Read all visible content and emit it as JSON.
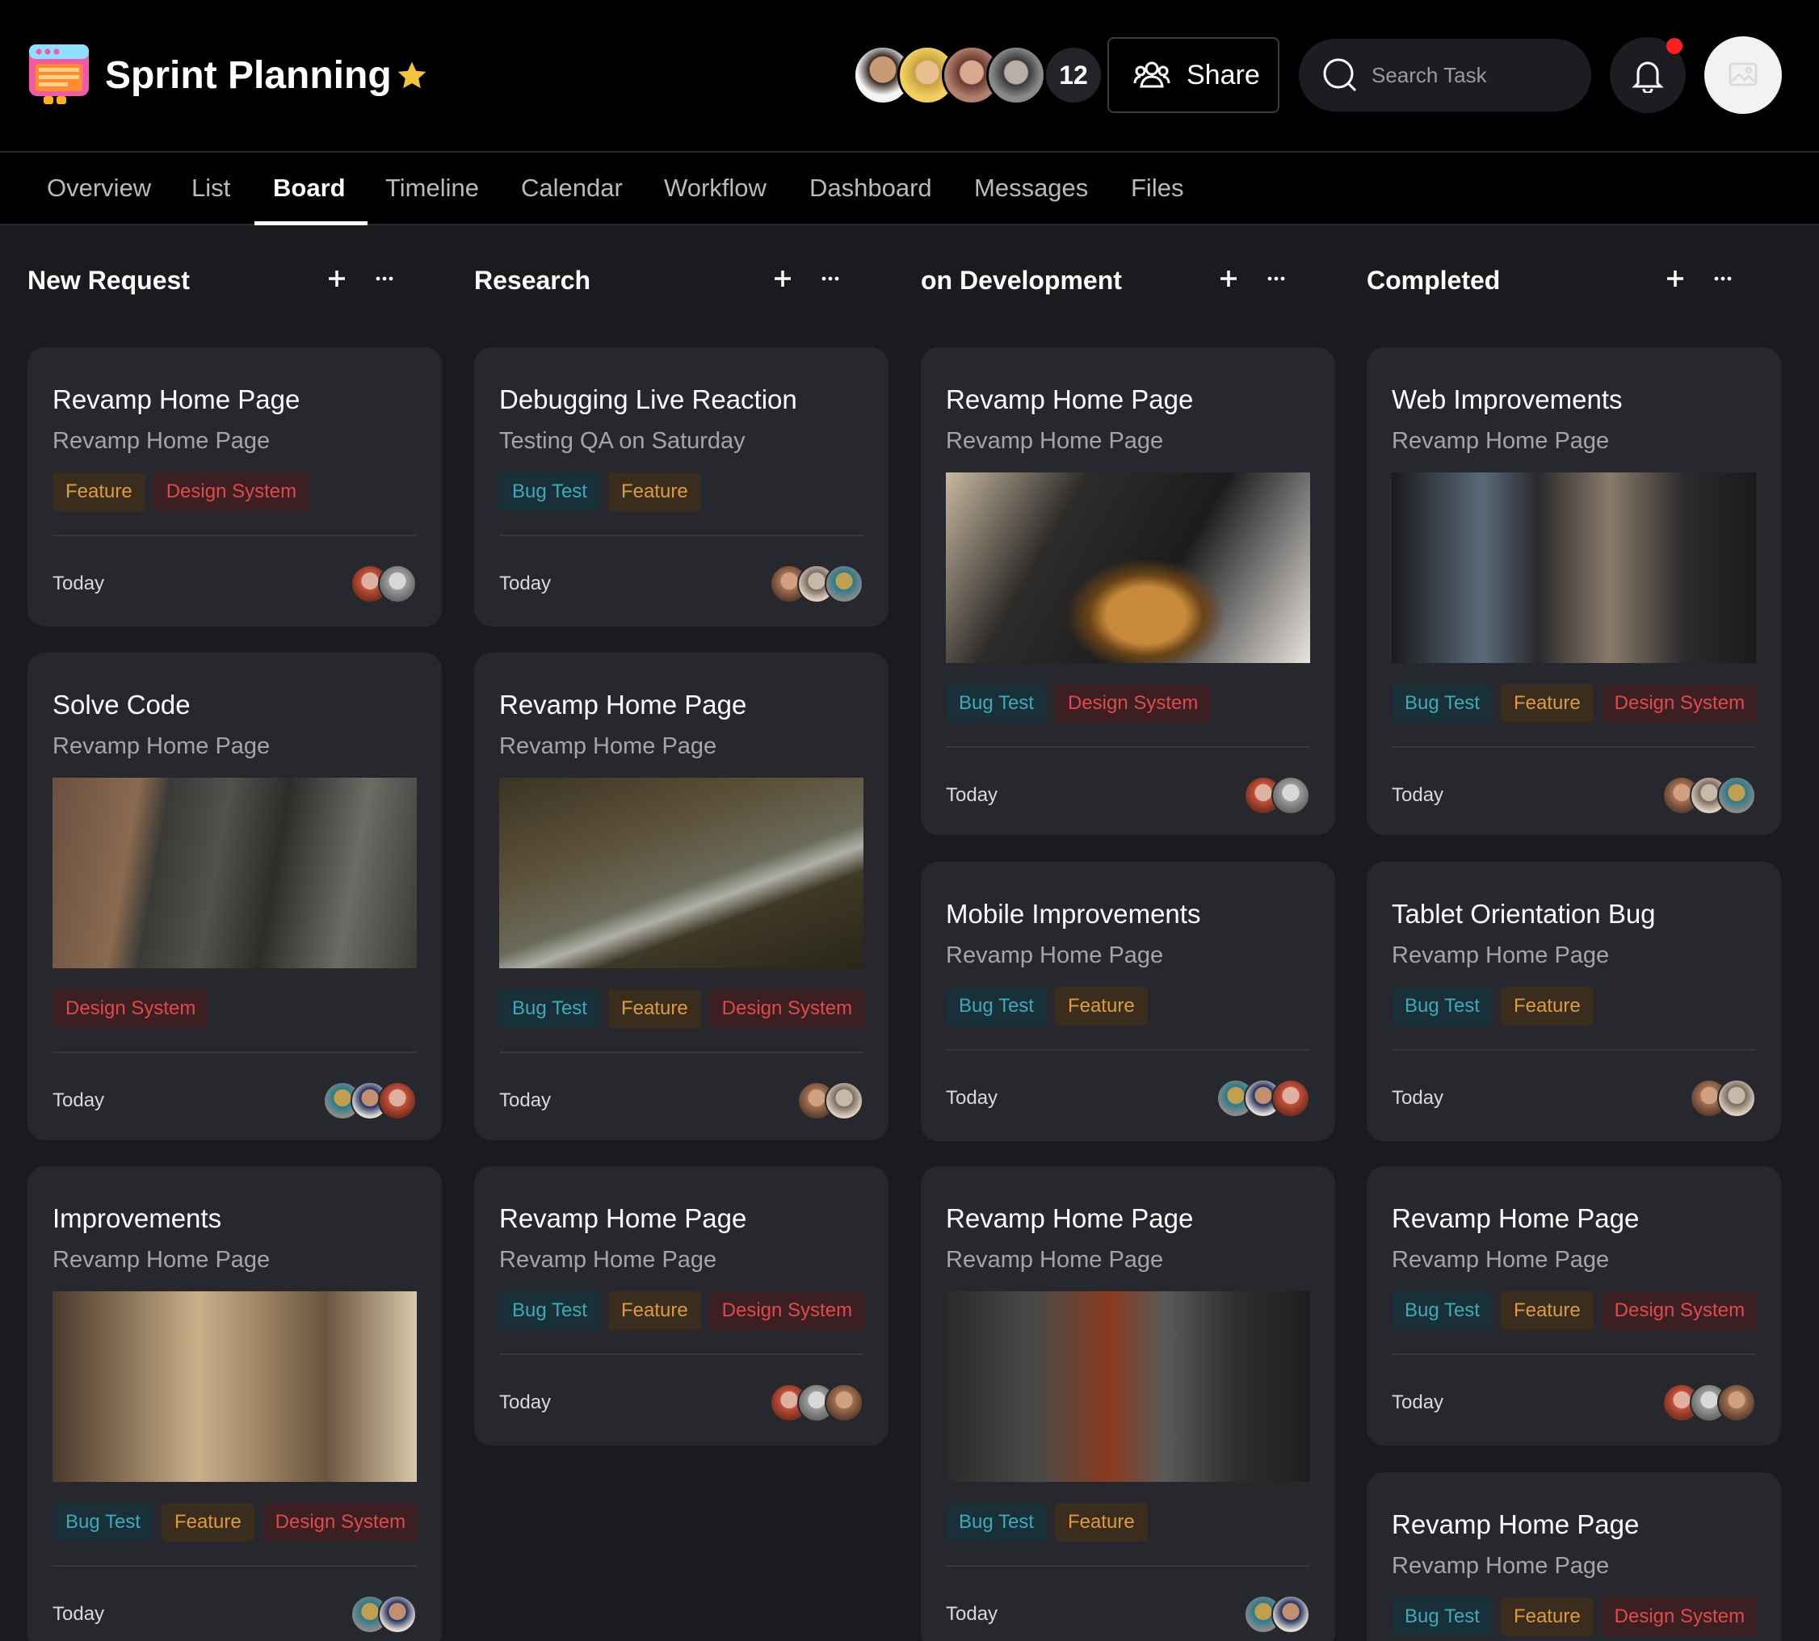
{
  "app": {
    "title": "Sprint Planning",
    "logo_icon": "board-logo-icon",
    "favorite_icon": "star-icon",
    "member_extra_count": "12",
    "share_label": "Share",
    "search_placeholder": "Search Task",
    "accent": "#f3c43c",
    "notification_color": "#ff1f1f"
  },
  "tabs": [
    "Overview",
    "List",
    "Board",
    "Timeline",
    "Calendar",
    "Workflow",
    "Dashboard",
    "Messages",
    "Files"
  ],
  "active_tab": "Board",
  "tag_colors": {
    "Bug Test": "#3fa9bc",
    "Feature": "#dd9a3e",
    "Design System": "#e04a4a"
  },
  "columns": [
    {
      "title": "New Request",
      "cards": [
        {
          "title": "Revamp Home Page",
          "subtitle": "Revamp Home Page",
          "tags": [
            "Feature",
            "Design System"
          ],
          "date": "Today",
          "image": null
        },
        {
          "title": "Solve Code",
          "subtitle": "Revamp Home Page",
          "tags": [
            "Design System"
          ],
          "date": "Today",
          "image": "treehouse-forest-photo"
        },
        {
          "title": "Improvements",
          "subtitle": "Revamp Home Page",
          "tags": [
            "Bug Test",
            "Feature",
            "Design System"
          ],
          "date": "Today",
          "image": "classical-building-photo"
        }
      ]
    },
    {
      "title": "Research",
      "cards": [
        {
          "title": "Debugging Live Reaction",
          "subtitle": "Testing QA on Saturday",
          "tags": [
            "Bug Test",
            "Feature"
          ],
          "date": "Today",
          "image": null
        },
        {
          "title": "Revamp Home Page",
          "subtitle": "Revamp Home Page",
          "tags": [
            "Bug Test",
            "Feature",
            "Design System"
          ],
          "date": "Today",
          "image": "castle-forest-photo"
        },
        {
          "title": "Revamp Home Page",
          "subtitle": "Revamp Home Page",
          "tags": [
            "Bug Test",
            "Feature",
            "Design System"
          ],
          "date": "Today",
          "image": null
        }
      ]
    },
    {
      "title": "on Development",
      "cards": [
        {
          "title": "Revamp Home Page",
          "subtitle": "Revamp Home Page",
          "tags": [
            "Bug Test",
            "Design System"
          ],
          "date": "Today",
          "image": "amber-glass-photo"
        },
        {
          "title": "Mobile Improvements",
          "subtitle": "Revamp Home Page",
          "tags": [
            "Bug Test",
            "Feature"
          ],
          "date": "Today",
          "image": null
        },
        {
          "title": "Revamp Home Page",
          "subtitle": "Revamp Home Page",
          "tags": [
            "Bug Test",
            "Feature"
          ],
          "date": "Today",
          "image": "city-alley-photo"
        }
      ]
    },
    {
      "title": "Completed",
      "cards": [
        {
          "title": "Web Improvements",
          "subtitle": "Revamp Home Page",
          "tags": [
            "Bug Test",
            "Feature",
            "Design System"
          ],
          "date": "Today",
          "image": "dark-street-photo"
        },
        {
          "title": "Tablet Orientation Bug",
          "subtitle": "Revamp Home Page",
          "tags": [
            "Bug Test",
            "Feature"
          ],
          "date": "Today",
          "image": null
        },
        {
          "title": "Revamp Home Page",
          "subtitle": "Revamp Home Page",
          "tags": [
            "Bug Test",
            "Feature",
            "Design System"
          ],
          "date": "Today",
          "image": null
        },
        {
          "title": "Revamp Home Page",
          "subtitle": "Revamp Home Page",
          "tags": [
            "Bug Test",
            "Feature",
            "Design System"
          ],
          "date": null,
          "image": null
        }
      ]
    }
  ]
}
